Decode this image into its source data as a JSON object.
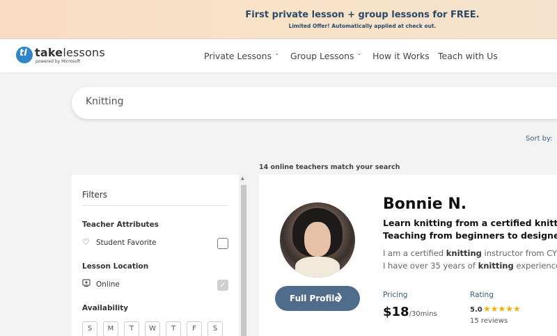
{
  "promo": {
    "title": "First private lesson + group lessons for FREE.",
    "subtitle": "Limited Offer! Automatically applied at check out."
  },
  "navbar": {
    "logo_take": "take",
    "logo_lessons": "lessons",
    "logo_sub": "powered by Microsoft",
    "items": [
      {
        "label": "Private Lessons",
        "has_caret": true
      },
      {
        "label": "Group Lessons",
        "has_caret": true
      },
      {
        "label": "How it Works",
        "has_caret": false
      },
      {
        "label": "Teach with Us",
        "has_caret": false
      }
    ]
  },
  "search": {
    "value": "Knitting"
  },
  "results": {
    "sort_label": "Sort by:",
    "match_count": "14 online teachers match your search"
  },
  "filters": {
    "title": "Filters",
    "teacher_attributes": {
      "title": "Teacher Attributes",
      "option": "Student Favorite",
      "checked": false
    },
    "lesson_location": {
      "title": "Lesson Location",
      "option": "Online",
      "checked": true
    },
    "availability": {
      "title": "Availability",
      "days": [
        "S",
        "M",
        "T",
        "W",
        "T",
        "F",
        "S"
      ]
    }
  },
  "teacher": {
    "name": "Bonnie N.",
    "tagline_1": "Learn knitting from a certified knitting",
    "tagline_2": "Teaching from beginners to designers.",
    "bio_1_pre": "I am a certified ",
    "bio_1_bold": "knitting",
    "bio_1_post": " instructor from CYC",
    "bio_2_pre": "I have over 35 years of ",
    "bio_2_bold": "knitting",
    "bio_2_post": " experience. I",
    "full_profile_label": "Full Profile",
    "pricing_label": "Pricing",
    "price": "$18",
    "price_unit": "/30mins",
    "rating_label": "Rating",
    "rating_value": "5.0",
    "stars": "★★★★★",
    "reviews": "15 reviews"
  },
  "colors": {
    "accent": "#4f6d8b",
    "promo_text": "#2b4a66",
    "star": "#f2b100"
  }
}
